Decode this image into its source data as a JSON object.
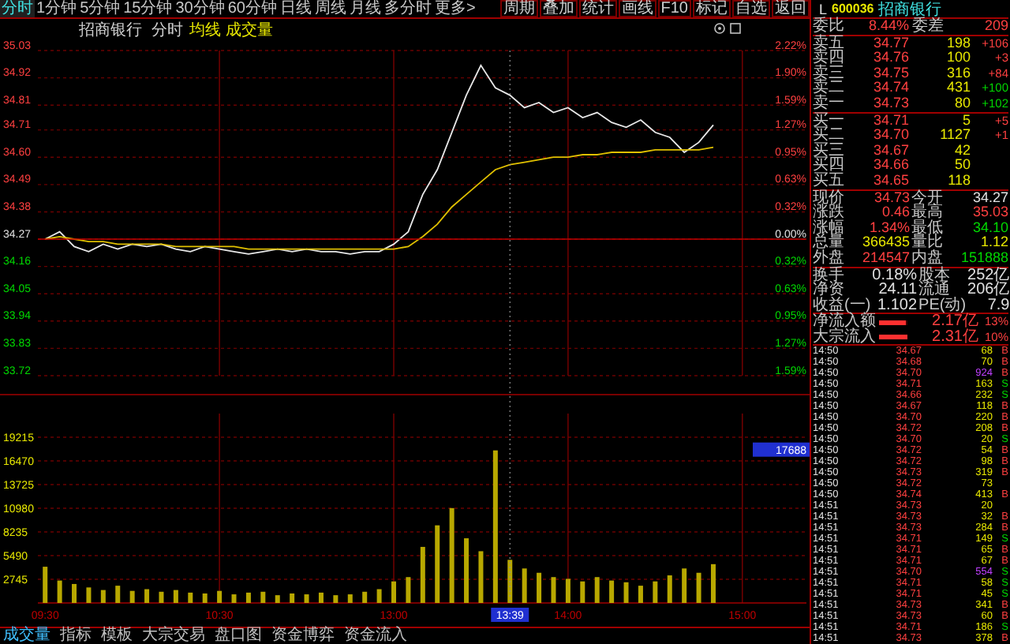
{
  "period_tabs": [
    {
      "label": "分时",
      "selected": true
    },
    {
      "label": "1分钟",
      "selected": false
    },
    {
      "label": "5分钟",
      "selected": false
    },
    {
      "label": "15分钟",
      "selected": false
    },
    {
      "label": "30分钟",
      "selected": false
    },
    {
      "label": "60分钟",
      "selected": false
    },
    {
      "label": "日线",
      "selected": false
    },
    {
      "label": "周线",
      "selected": false
    },
    {
      "label": "月线",
      "selected": false
    },
    {
      "label": "多分时",
      "selected": false
    },
    {
      "label": "更多>",
      "selected": false
    }
  ],
  "toolbar_buttons": [
    "周期",
    "叠加",
    "统计",
    "画线",
    "F10",
    "标记",
    "自选",
    "返回"
  ],
  "chart_header": {
    "name": "招商银行",
    "mode": "分时",
    "volume_label": "成交量"
  },
  "price_chart": {
    "right_labels": [
      {
        "label": "2.22%",
        "color": "#ff4040"
      },
      {
        "label": "1.90%",
        "color": "#ff4040"
      },
      {
        "label": "1.59%",
        "color": "#ff4040"
      },
      {
        "label": "1.27%",
        "color": "#ff4040"
      },
      {
        "label": "0.95%",
        "color": "#ff4040"
      },
      {
        "label": "0.63%",
        "color": "#ff4040"
      },
      {
        "label": "0.32%",
        "color": "#ff4040"
      },
      {
        "label": "0.00%",
        "color": "#e0e0e0"
      },
      {
        "label": "0.32%",
        "color": "#00d800"
      },
      {
        "label": "0.63%",
        "color": "#00d800"
      },
      {
        "label": "0.95%",
        "color": "#00d800"
      },
      {
        "label": "1.27%",
        "color": "#00d800"
      },
      {
        "label": "1.59%",
        "color": "#00d800"
      }
    ],
    "chart_data": {
      "type": "line",
      "grid": true,
      "ylim": [
        33.72,
        35.03
      ],
      "yticks": [
        {
          "value": 35.03,
          "label": "35.03"
        },
        {
          "value": 34.92,
          "label": "34.92"
        },
        {
          "value": 34.81,
          "label": "34.81"
        },
        {
          "value": 34.71,
          "label": "34.71"
        },
        {
          "value": 34.6,
          "label": "34.60"
        },
        {
          "value": 34.49,
          "label": "34.49"
        },
        {
          "value": 34.38,
          "label": "34.38"
        },
        {
          "value": 34.27,
          "label": "34.27"
        },
        {
          "value": 34.16,
          "label": "34.16"
        },
        {
          "value": 34.05,
          "label": "34.05"
        },
        {
          "value": 33.94,
          "label": "33.94"
        },
        {
          "value": 33.83,
          "label": "33.83"
        },
        {
          "value": 33.72,
          "label": "33.72"
        }
      ],
      "categories": [
        null,
        null,
        null,
        null,
        null,
        null,
        null,
        null,
        null,
        null,
        null,
        null,
        null,
        null,
        null,
        null,
        null,
        null,
        null,
        null,
        null,
        null,
        null,
        null,
        null,
        null,
        null,
        null,
        null,
        null,
        null,
        null,
        null,
        null,
        null,
        null,
        null,
        null,
        null,
        null,
        null,
        null,
        null,
        null,
        null,
        null,
        null,
        null,
        null
      ],
      "series": [
        {
          "color": "#e8e8e8",
          "values": [
            34.27,
            34.3,
            34.24,
            34.22,
            34.25,
            34.23,
            34.25,
            34.24,
            34.25,
            34.23,
            34.22,
            34.24,
            34.23,
            34.22,
            34.21,
            34.22,
            34.23,
            34.22,
            34.23,
            34.22,
            34.22,
            34.21,
            34.22,
            34.22,
            34.25,
            34.3,
            34.45,
            34.55,
            34.7,
            34.85,
            34.97,
            34.88,
            34.85,
            34.8,
            34.82,
            34.78,
            34.8,
            34.76,
            34.78,
            34.74,
            34.72,
            34.75,
            34.7,
            34.68,
            34.62,
            34.66,
            34.73,
            null,
            null
          ]
        },
        {
          "name": "均线",
          "color": "#e0c000",
          "values": [
            34.27,
            34.28,
            34.27,
            34.26,
            34.26,
            34.25,
            34.25,
            34.25,
            34.25,
            34.24,
            34.24,
            34.24,
            34.24,
            34.24,
            34.23,
            34.23,
            34.23,
            34.23,
            34.23,
            34.23,
            34.23,
            34.23,
            34.23,
            34.23,
            34.23,
            34.24,
            34.28,
            34.33,
            34.4,
            34.45,
            34.5,
            34.55,
            34.57,
            34.58,
            34.59,
            34.6,
            34.6,
            34.61,
            34.61,
            34.62,
            34.62,
            34.62,
            34.63,
            34.63,
            34.63,
            34.63,
            34.64,
            null,
            null
          ]
        }
      ]
    }
  },
  "volume_chart": {
    "chart_data": {
      "type": "bar",
      "grid": true,
      "ylim": [
        0,
        21960
      ],
      "yticks": [
        19215,
        16470,
        13725,
        10980,
        8235,
        5490,
        2745
      ],
      "categories": [
        "09:30",
        null,
        null,
        null,
        null,
        null,
        null,
        null,
        null,
        null,
        null,
        null,
        "10:30",
        null,
        null,
        null,
        null,
        null,
        null,
        null,
        null,
        null,
        null,
        null,
        "13:00",
        null,
        null,
        null,
        null,
        null,
        null,
        null,
        "13:39",
        null,
        null,
        null,
        "14:00",
        null,
        null,
        null,
        null,
        null,
        null,
        null,
        null,
        null,
        null,
        null,
        "15:00"
      ],
      "values": [
        4200,
        2600,
        2200,
        1800,
        1500,
        2000,
        1400,
        1600,
        1300,
        1500,
        1200,
        1100,
        1400,
        1000,
        1200,
        1300,
        900,
        1100,
        1000,
        1200,
        900,
        1000,
        1300,
        1600,
        2500,
        3000,
        6500,
        9000,
        11000,
        7500,
        6000,
        17688,
        5000,
        4000,
        3500,
        3000,
        2800,
        2500,
        3000,
        2600,
        2400,
        2000,
        2500,
        3200,
        4000,
        3500,
        4500,
        null,
        null
      ],
      "annotations": [
        {
          "x": "13:39"
        },
        "17688"
      ]
    }
  },
  "bottom_tabs": [
    {
      "label": "成交量",
      "selected": true
    },
    {
      "label": "指标",
      "selected": false
    },
    {
      "label": "模板",
      "selected": false
    },
    {
      "label": "大宗交易",
      "selected": false
    },
    {
      "label": "盘口图",
      "selected": false
    },
    {
      "label": "资金博弈",
      "selected": false
    },
    {
      "label": "资金流入",
      "selected": false
    }
  ],
  "quote_header": {
    "marker": "L",
    "code": "600036",
    "name": "招商银行"
  },
  "order_ratio": {
    "label": "委比",
    "value": "8.44%",
    "label2": "委差",
    "value2": "209"
  },
  "asks": [
    {
      "label": "卖五",
      "price": "34.77",
      "volume": "198",
      "change": "+106",
      "color": "#ff4040"
    },
    {
      "label": "卖四",
      "price": "34.76",
      "volume": "100",
      "change": "+3",
      "color": "#ff4040"
    },
    {
      "label": "卖三",
      "price": "34.75",
      "volume": "316",
      "change": "+84",
      "color": "#ff4040"
    },
    {
      "label": "卖二",
      "price": "34.74",
      "volume": "431",
      "change": "+100",
      "color": "#00d800"
    },
    {
      "label": "卖一",
      "price": "34.73",
      "volume": "80",
      "change": "+102",
      "color": "#00d800"
    }
  ],
  "bids": [
    {
      "label": "买一",
      "price": "34.71",
      "volume": "5",
      "change": "+5",
      "color": "#ff4040"
    },
    {
      "label": "买二",
      "price": "34.70",
      "volume": "1127",
      "change": "+1",
      "color": "#ff4040"
    },
    {
      "label": "买三",
      "price": "34.67",
      "volume": "42"
    },
    {
      "label": "买四",
      "price": "34.66",
      "volume": "50"
    },
    {
      "label": "买五",
      "price": "34.65",
      "volume": "118"
    }
  ],
  "stats": [
    {
      "label": "现价",
      "value": "34.73",
      "color": "#ff4040"
    },
    {
      "label": "今开",
      "value": "34.27",
      "color": "#e0e0e0"
    },
    {
      "label": "涨跌",
      "value": "0.46",
      "color": "#ff4040"
    },
    {
      "label": "最高",
      "value": "35.03",
      "color": "#ff4040"
    },
    {
      "label": "涨幅",
      "value": "1.34%",
      "color": "#ff4040"
    },
    {
      "label": "最低",
      "value": "34.10",
      "color": "#00d800"
    },
    {
      "label": "总量",
      "value": "366435",
      "color": "#e8e800"
    },
    {
      "label": "量比",
      "value": "1.12",
      "color": "#e8e800"
    },
    {
      "label": "外盘",
      "value": "214547",
      "color": "#ff4040"
    },
    {
      "label": "内盘",
      "value": "151888",
      "color": "#00d800"
    }
  ],
  "fundamentals": [
    {
      "label": "换手",
      "value": "0.18%"
    },
    {
      "label": "股本",
      "value": "252亿"
    },
    {
      "label": "净资",
      "value": "24.11"
    },
    {
      "label": "流通",
      "value": "206亿"
    },
    {
      "label": "收益(一)",
      "value": "1.102"
    },
    {
      "label": "PE(动)",
      "value": "7.9"
    }
  ],
  "fund_flows": [
    {
      "label": "净流入额",
      "level": 0.95,
      "amount": "2.17亿",
      "percent": "13%"
    },
    {
      "label": "大宗流入",
      "level": 1,
      "amount": "2.31亿",
      "percent": "10%"
    }
  ],
  "ticks": [
    {
      "time": "14:50",
      "price": "34.67",
      "volume": "68",
      "side": "B",
      "kind": "buy",
      "large": false
    },
    {
      "time": "14:50",
      "price": "34.68",
      "volume": "70",
      "side": "B",
      "kind": "buy",
      "large": false
    },
    {
      "time": "14:50",
      "price": "34.70",
      "volume": "924",
      "side": "B",
      "kind": "buy",
      "large": true
    },
    {
      "time": "14:50",
      "price": "34.71",
      "volume": "163",
      "side": "S",
      "kind": "sell",
      "large": false
    },
    {
      "time": "14:50",
      "price": "34.66",
      "volume": "232",
      "side": "S",
      "kind": "sell",
      "large": false
    },
    {
      "time": "14:50",
      "price": "34.67",
      "volume": "118",
      "side": "B",
      "kind": "buy",
      "large": false
    },
    {
      "time": "14:50",
      "price": "34.70",
      "volume": "220",
      "side": "B",
      "kind": "buy",
      "large": false
    },
    {
      "time": "14:50",
      "price": "34.72",
      "volume": "208",
      "side": "B",
      "kind": "buy",
      "large": false
    },
    {
      "time": "14:50",
      "price": "34.70",
      "volume": "20",
      "side": "S",
      "kind": "sell",
      "large": false
    },
    {
      "time": "14:50",
      "price": "34.72",
      "volume": "54",
      "side": "B",
      "kind": "buy",
      "large": false
    },
    {
      "time": "14:50",
      "price": "34.72",
      "volume": "98",
      "side": "B",
      "kind": "buy",
      "large": false
    },
    {
      "time": "14:50",
      "price": "34.73",
      "volume": "319",
      "side": "B",
      "kind": "buy",
      "large": false
    },
    {
      "time": "14:50",
      "price": "34.72",
      "volume": "73",
      "kind": "none",
      "large": false
    },
    {
      "time": "14:50",
      "price": "34.74",
      "volume": "413",
      "side": "B",
      "kind": "buy",
      "large": false
    },
    {
      "time": "14:51",
      "price": "34.73",
      "volume": "20",
      "kind": "none",
      "large": false
    },
    {
      "time": "14:51",
      "price": "34.73",
      "volume": "32",
      "side": "B",
      "kind": "buy",
      "large": false
    },
    {
      "time": "14:51",
      "price": "34.73",
      "volume": "284",
      "side": "B",
      "kind": "buy",
      "large": false
    },
    {
      "time": "14:51",
      "price": "34.71",
      "volume": "149",
      "side": "S",
      "kind": "sell",
      "large": false
    },
    {
      "time": "14:51",
      "price": "34.71",
      "volume": "65",
      "side": "B",
      "kind": "buy",
      "large": false
    },
    {
      "time": "14:51",
      "price": "34.71",
      "volume": "67",
      "side": "B",
      "kind": "buy",
      "large": false
    },
    {
      "time": "14:51",
      "price": "34.70",
      "volume": "554",
      "side": "S",
      "kind": "sell",
      "large": true
    },
    {
      "time": "14:51",
      "price": "34.71",
      "volume": "58",
      "side": "S",
      "kind": "sell",
      "large": false
    },
    {
      "time": "14:51",
      "price": "34.71",
      "volume": "45",
      "side": "S",
      "kind": "sell",
      "large": false
    },
    {
      "time": "14:51",
      "price": "34.73",
      "volume": "341",
      "side": "B",
      "kind": "buy",
      "large": false
    },
    {
      "time": "14:51",
      "price": "34.73",
      "volume": "60",
      "side": "B",
      "kind": "buy",
      "large": false
    },
    {
      "time": "14:51",
      "price": "34.71",
      "volume": "186",
      "side": "S",
      "kind": "sell",
      "large": false
    },
    {
      "time": "14:51",
      "price": "34.73",
      "volume": "378",
      "side": "B",
      "kind": "buy",
      "large": false
    }
  ]
}
